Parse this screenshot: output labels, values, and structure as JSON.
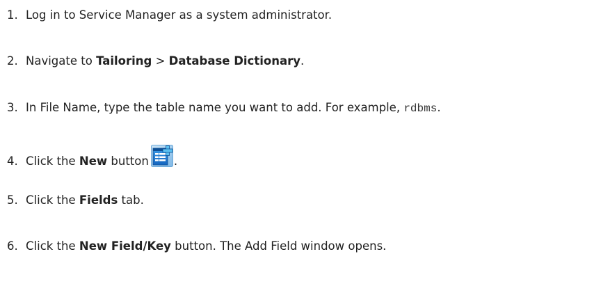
{
  "steps": [
    {
      "number": "1.",
      "text": "Log in to Service Manager as a system administrator."
    },
    {
      "number": "2.",
      "prefix": "Navigate to ",
      "bold1": "Tailoring",
      "separator": " > ",
      "bold2": "Database Dictionary",
      "suffix": "."
    },
    {
      "number": "3.",
      "text": "In File Name, type the table name you want to add. For example, ",
      "code": "rdbms",
      "suffix": "."
    },
    {
      "number": "4.",
      "prefix": "Click the ",
      "bold": "New",
      "middle": " button",
      "icon": "new-record-icon",
      "suffix": "."
    },
    {
      "number": "5.",
      "prefix": "Click the ",
      "bold": "Fields",
      "suffix": " tab."
    },
    {
      "number": "6.",
      "prefix": "Click the ",
      "bold": "New Field/Key",
      "suffix": " button. The Add Field window opens."
    }
  ],
  "colors": {
    "text": "#222222",
    "icon_blue": "#1f7fd6",
    "icon_plus": "#5bc0f0"
  }
}
